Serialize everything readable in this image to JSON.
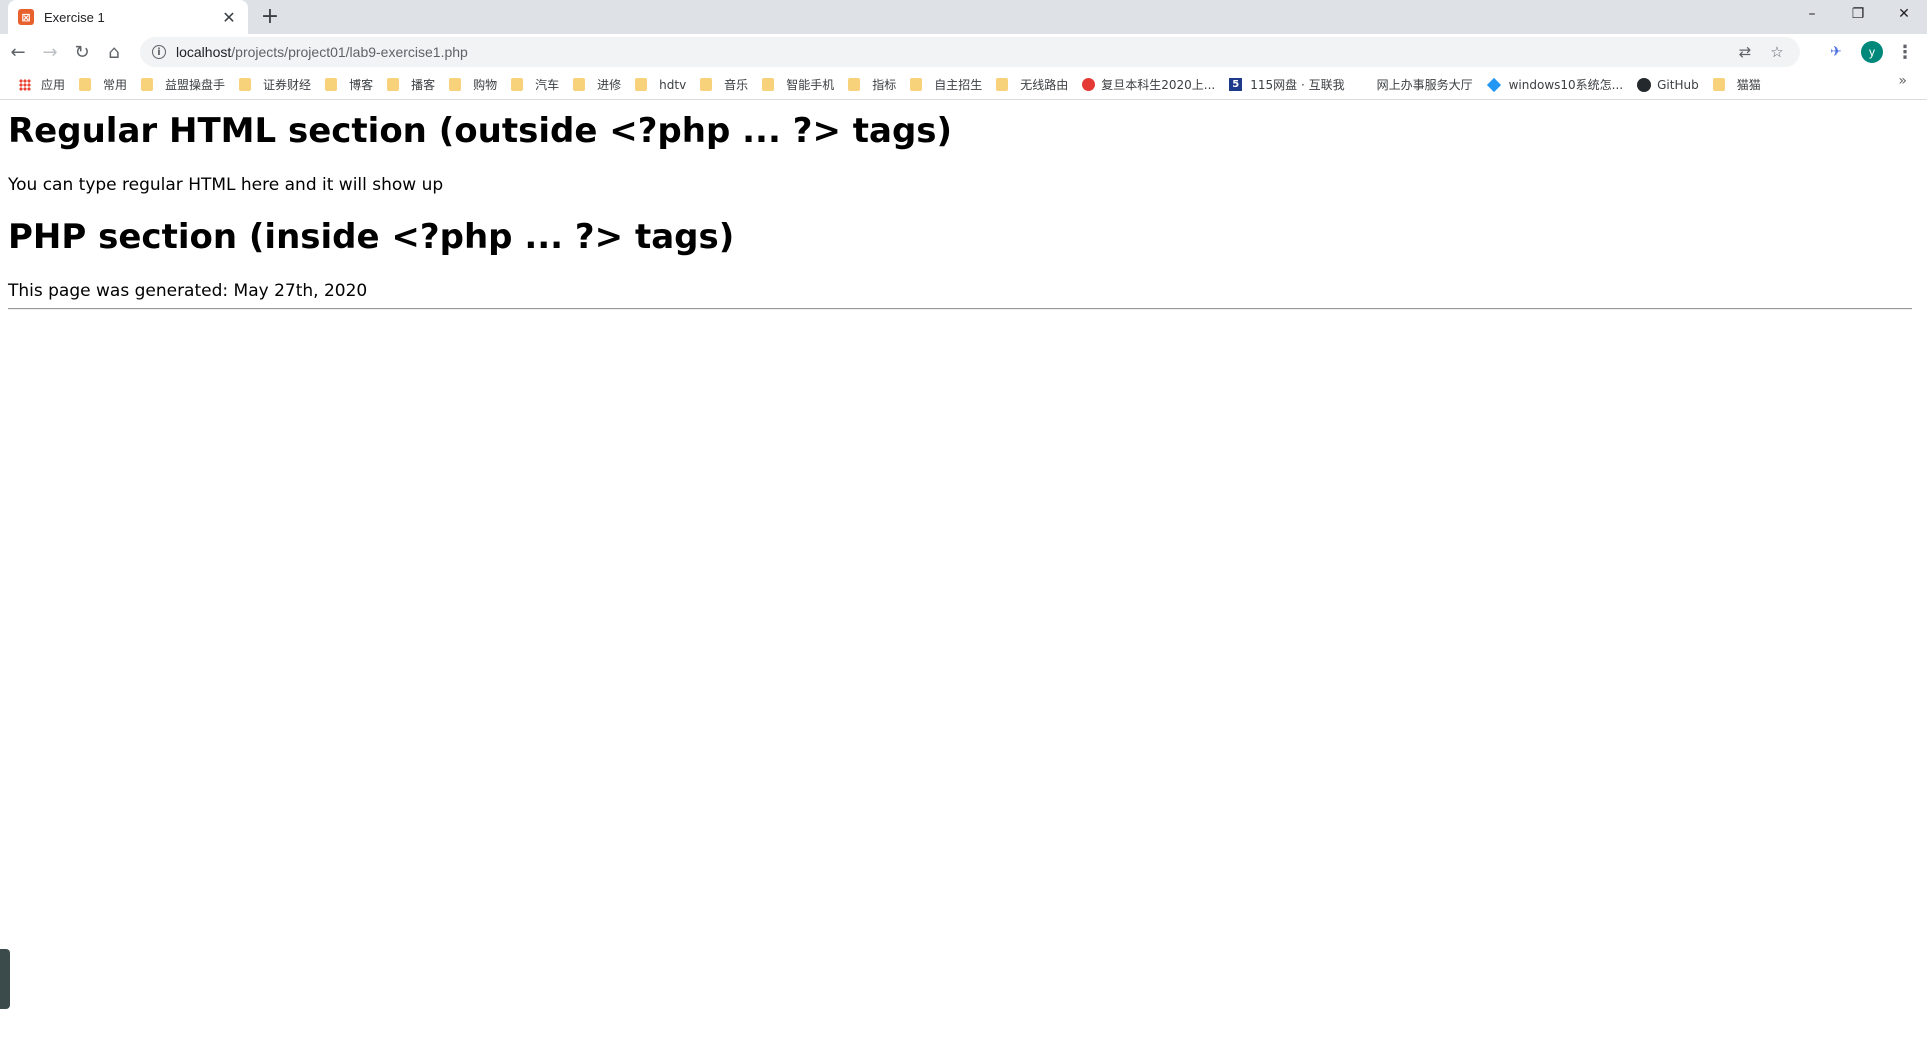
{
  "browser": {
    "tab": {
      "title": "Exercise 1",
      "favicon": "xampp-icon",
      "close_glyph": "✕"
    },
    "new_tab_glyph": "+",
    "window_controls": {
      "minimize": "–",
      "restore": "❐",
      "close": "✕"
    },
    "nav": {
      "back": "←",
      "forward": "→",
      "reload": "↻",
      "home": "⌂"
    },
    "address": {
      "host": "localhost",
      "path": "/projects/project01/lab9-exercise1.php"
    },
    "profile_initial": "y",
    "menu_glyph": "⋮"
  },
  "bookmarks": [
    {
      "label": "应用",
      "icon": "apps-icon"
    },
    {
      "label": "常用",
      "icon": "folder-icon"
    },
    {
      "label": "益盟操盘手",
      "icon": "folder-icon"
    },
    {
      "label": "证券财经",
      "icon": "folder-icon"
    },
    {
      "label": "博客",
      "icon": "folder-icon"
    },
    {
      "label": "播客",
      "icon": "folder-icon"
    },
    {
      "label": "购物",
      "icon": "folder-icon"
    },
    {
      "label": "汽车",
      "icon": "folder-icon"
    },
    {
      "label": "进修",
      "icon": "folder-icon"
    },
    {
      "label": "hdtv",
      "icon": "folder-icon"
    },
    {
      "label": "音乐",
      "icon": "folder-icon"
    },
    {
      "label": "智能手机",
      "icon": "folder-icon"
    },
    {
      "label": "指标",
      "icon": "folder-icon"
    },
    {
      "label": "自主招生",
      "icon": "folder-icon"
    },
    {
      "label": "无线路由",
      "icon": "folder-icon"
    },
    {
      "label": "复旦本科生2020上...",
      "icon": "fudan-icon"
    },
    {
      "label": "115网盘 · 互联我",
      "icon": "115-icon"
    },
    {
      "label": "网上办事服务大厅",
      "icon": "none"
    },
    {
      "label": "windows10系统怎...",
      "icon": "gem-icon"
    },
    {
      "label": "GitHub",
      "icon": "github-icon"
    },
    {
      "label": "猫猫",
      "icon": "folder-icon"
    }
  ],
  "bookmarks_overflow": "»",
  "page": {
    "heading1": "Regular HTML section (outside <?php ... ?> tags)",
    "para1": "You can type regular HTML here and it will show up",
    "heading2": "PHP section (inside <?php ... ?> tags)",
    "para2": "This page was generated: May 27th, 2020"
  },
  "colors": {
    "tabstrip": "#dee1e6",
    "omnibox": "#f1f3f4",
    "avatar": "#00897b",
    "folder": "#f7d27b"
  }
}
